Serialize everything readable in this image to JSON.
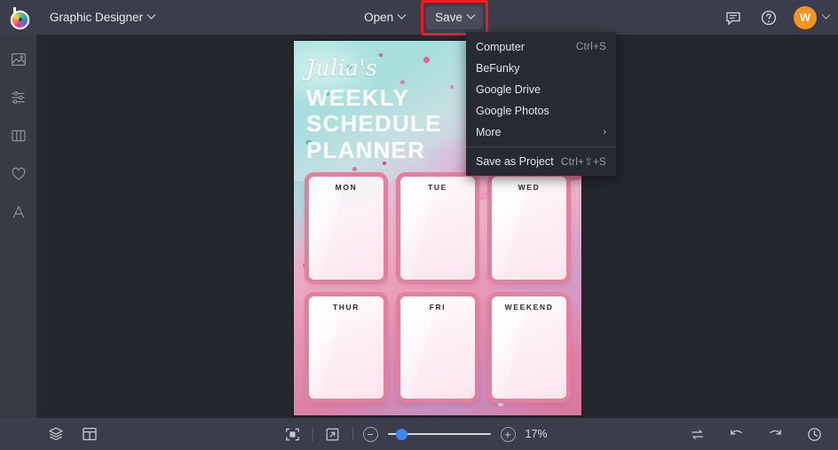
{
  "app": {
    "brand": "BeFunky",
    "accent_color": "#3b87f0",
    "highlight_color": "#ee1c25",
    "avatar_color": "#f59220"
  },
  "header": {
    "workspace_label": "Graphic Designer",
    "open_label": "Open",
    "save_label": "Save",
    "icons": {
      "feedback": "chat-icon",
      "help": "help-icon",
      "avatar_initial": "W"
    }
  },
  "sidebar": {
    "items": [
      {
        "name": "image",
        "icon": "image-icon"
      },
      {
        "name": "edit",
        "icon": "sliders-icon"
      },
      {
        "name": "templates",
        "icon": "columns-icon"
      },
      {
        "name": "graphics",
        "icon": "heart-icon"
      },
      {
        "name": "text",
        "icon": "text-a-icon"
      }
    ]
  },
  "save_menu": {
    "items": [
      {
        "label": "Computer",
        "shortcut": "Ctrl+S",
        "arrow": ""
      },
      {
        "label": "BeFunky",
        "shortcut": "",
        "arrow": ""
      },
      {
        "label": "Google Drive",
        "shortcut": "",
        "arrow": ""
      },
      {
        "label": "Google Photos",
        "shortcut": "",
        "arrow": ""
      },
      {
        "label": "More",
        "shortcut": "",
        "arrow": "›"
      }
    ],
    "footer": {
      "label": "Save as Project",
      "shortcut": "Ctrl+⇧+S"
    }
  },
  "canvas": {
    "script_title": "Julia's",
    "title_line_1": "WEEKLY",
    "title_line_2": "SCHEDULE",
    "title_line_3": "PLANNER",
    "days": [
      "MON",
      "TUE",
      "WED",
      "THUR",
      "FRI",
      "WEEKEND"
    ]
  },
  "bottombar": {
    "layers_icon": "layers-icon",
    "layout_icon": "layout-icon",
    "fit_icon": "fit-to-screen-icon",
    "fullscreen_icon": "expand-icon",
    "zoom_out_label": "−",
    "zoom_in_label": "+",
    "zoom_level": "17%",
    "compare_icon": "compare-icon",
    "undo_icon": "undo-icon",
    "redo_icon": "redo-icon",
    "history_icon": "history-icon"
  }
}
